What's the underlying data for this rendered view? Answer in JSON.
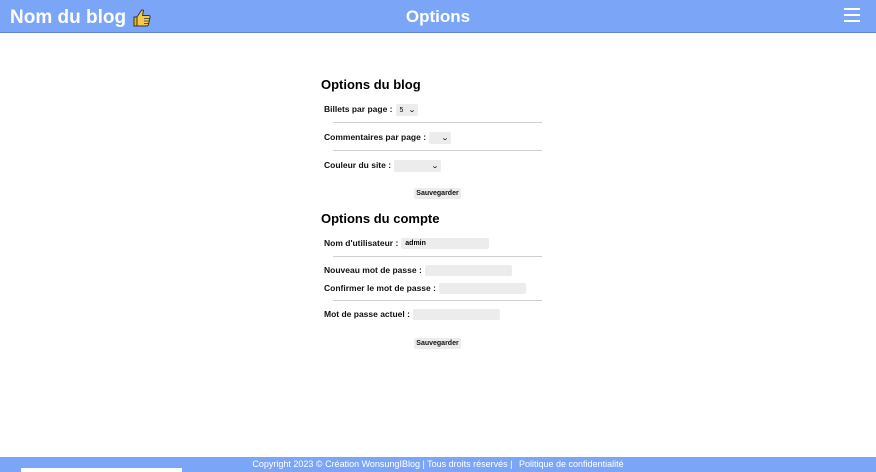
{
  "header": {
    "brand": "Nom du blog",
    "brand_icon": "thumbs-up-icon",
    "title": "Options",
    "menu_icon": "hamburger-menu-icon",
    "color": "#7ba6f8"
  },
  "blog_options": {
    "title": "Options du blog",
    "posts_per_page": {
      "label": "Billets par page :",
      "value": "5"
    },
    "comments_per_page": {
      "label": "Commentaires par page :",
      "value": ""
    },
    "site_color": {
      "label": "Couleur du site :",
      "value": ""
    },
    "save_label": "Sauvegarder"
  },
  "account_options": {
    "title": "Options du compte",
    "username": {
      "label": "Nom d'utilisateur :",
      "value": "admin"
    },
    "new_password": {
      "label": "Nouveau mot de passe :",
      "value": ""
    },
    "confirm_password": {
      "label": "Confirmer le mot de passe :",
      "value": ""
    },
    "current_password": {
      "label": "Mot de passe actuel :",
      "value": ""
    },
    "save_label": "Sauvegarder"
  },
  "footer": {
    "copyright": "Copyright 2023 © Création WonsungIBlog | Tous droits réservés |",
    "privacy_link": "Politique de confidentialité"
  }
}
